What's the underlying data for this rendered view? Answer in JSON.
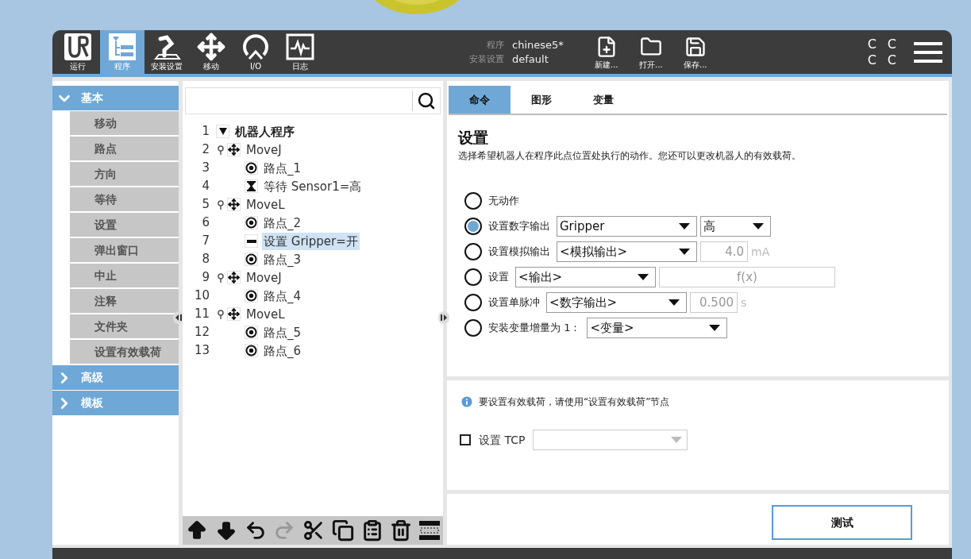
{
  "header": {
    "nav_tabs": [
      {
        "label": "运行",
        "selected": false
      },
      {
        "label": "程序",
        "selected": true
      },
      {
        "label": "安装设置",
        "selected": false
      },
      {
        "label": "移动",
        "selected": false
      },
      {
        "label": "I/O",
        "selected": false
      },
      {
        "label": "日志",
        "selected": false
      }
    ],
    "program_label": "程序",
    "program_value": "chinese5*",
    "installation_label": "安装设置",
    "installation_value": "default",
    "file_buttons": [
      {
        "label": "新建..."
      },
      {
        "label": "打开..."
      },
      {
        "label": "保存..."
      }
    ],
    "status_glyphs": [
      "C",
      "C",
      "C",
      "C"
    ]
  },
  "sidebar": {
    "sections": [
      {
        "label": "基本",
        "expanded": true,
        "items": [
          "移动",
          "路点",
          "方向",
          "等待",
          "设置",
          "弹出窗口",
          "中止",
          "注释",
          "文件夹",
          "设置有效载荷"
        ]
      },
      {
        "label": "高级",
        "expanded": false
      },
      {
        "label": "模板",
        "expanded": false
      }
    ]
  },
  "program_tree": {
    "nodes": [
      {
        "line": "1",
        "kind": "program",
        "label": "机器人程序",
        "selected": false,
        "expanded": true,
        "children": [
          {
            "line": "2",
            "kind": "move",
            "label": "MoveJ",
            "selected": false,
            "expanded": true,
            "children": [
              {
                "line": "3",
                "kind": "waypoint",
                "label": "路点_1",
                "selected": false
              },
              {
                "line": "4",
                "kind": "wait",
                "label": "等待 Sensor1=高",
                "selected": false
              }
            ]
          },
          {
            "line": "5",
            "kind": "move",
            "label": "MoveL",
            "selected": false,
            "expanded": true,
            "children": [
              {
                "line": "6",
                "kind": "waypoint",
                "label": "路点_2",
                "selected": false
              },
              {
                "line": "7",
                "kind": "set",
                "label": "设置 Gripper=开",
                "selected": true
              },
              {
                "line": "8",
                "kind": "waypoint",
                "label": "路点_3",
                "selected": false
              }
            ]
          },
          {
            "line": "9",
            "kind": "move",
            "label": "MoveJ",
            "selected": false,
            "expanded": true,
            "children": [
              {
                "line": "10",
                "kind": "waypoint",
                "label": "路点_4",
                "selected": false
              }
            ]
          },
          {
            "line": "11",
            "kind": "move",
            "label": "MoveL",
            "selected": false,
            "expanded": true,
            "children": [
              {
                "line": "12",
                "kind": "waypoint",
                "label": "路点_5",
                "selected": false
              },
              {
                "line": "13",
                "kind": "waypoint",
                "label": "路点_6",
                "selected": false
              }
            ]
          }
        ]
      }
    ],
    "toolbar": [
      {
        "kind": "up",
        "disabled": false
      },
      {
        "kind": "down",
        "disabled": false
      },
      {
        "kind": "undo",
        "disabled": false
      },
      {
        "kind": "redo",
        "disabled": true
      },
      {
        "kind": "cut",
        "disabled": false
      },
      {
        "kind": "copy",
        "disabled": false
      },
      {
        "kind": "paste",
        "disabled": false
      },
      {
        "kind": "delete",
        "disabled": false
      },
      {
        "kind": "suppress",
        "disabled": false
      }
    ]
  },
  "command_panel": {
    "tabs": [
      {
        "label": "命令",
        "selected": true
      },
      {
        "label": "图形",
        "selected": false
      },
      {
        "label": "变量",
        "selected": false
      }
    ],
    "title": "设置",
    "description": "选择希望机器人在程序此点位置处执行的动作。您还可以更改机器人的有效载荷。",
    "options": [
      {
        "kind": "none",
        "label": "无动作",
        "selected": false
      },
      {
        "kind": "digital",
        "label": "设置数字输出",
        "selected": true,
        "select": "Gripper",
        "value_select": "高"
      },
      {
        "kind": "analog",
        "label": "设置模拟输出",
        "selected": false,
        "select": "<模拟输出>",
        "value": "4.0",
        "unit": "mA"
      },
      {
        "kind": "expression",
        "label": "设置",
        "selected": false,
        "select": "<输出>",
        "value": "f(x)"
      },
      {
        "kind": "pulse",
        "label": "设置单脉冲",
        "selected": false,
        "select": "<数字输出>",
        "value": "0.500",
        "unit": "s"
      },
      {
        "kind": "increment",
        "label": "安装变量增量为 1：",
        "selected": false,
        "select": "<变量>"
      }
    ],
    "payload_info": "要设置有效载荷，请使用“设置有效载荷”节点",
    "tcp": {
      "label": "设置 TCP",
      "checked": false
    },
    "test_button": "测试"
  }
}
